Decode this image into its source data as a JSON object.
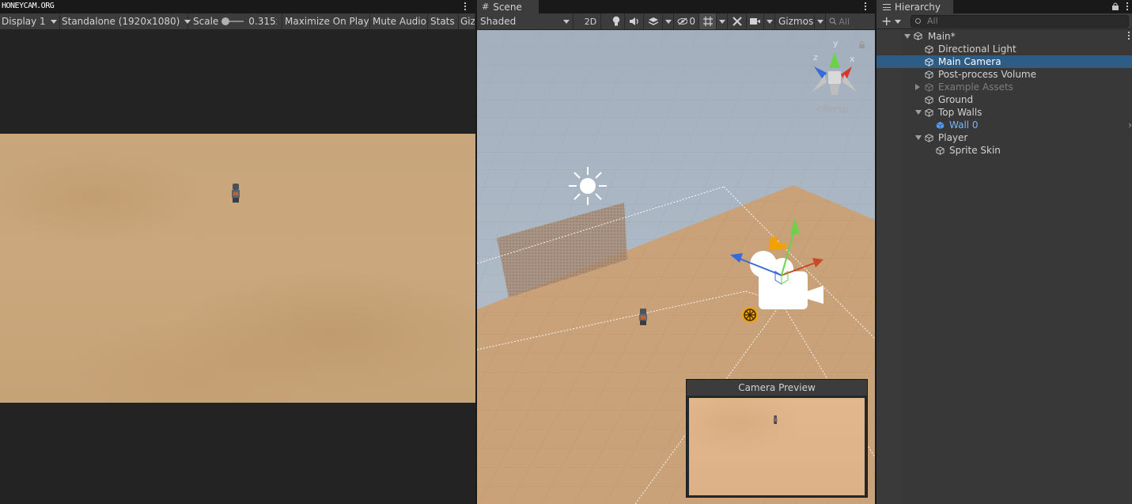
{
  "watermark": "HONEYCAM.ORG",
  "game": {
    "display": "Display 1",
    "resolution": "Standalone (1920x1080)",
    "scale_label": "Scale",
    "scale_value": "0.315x",
    "maximize": "Maximize On Play",
    "mute": "Mute Audio",
    "stats": "Stats",
    "gizmos": "Gizmos"
  },
  "scene": {
    "tab": "Scene",
    "shading": "Shaded",
    "mode_2d": "2D",
    "hidden_count": "0",
    "gizmos": "Gizmos",
    "search_placeholder": "All",
    "persp": "Persp",
    "gizmo_axes": {
      "x": "x",
      "y": "y",
      "z": "z"
    },
    "camera_preview_title": "Camera Preview"
  },
  "hierarchy": {
    "tab": "Hierarchy",
    "search_placeholder": "All",
    "add_symbol": "+",
    "items": [
      {
        "label": "Main*",
        "depth": 0,
        "expanded": true,
        "kind": "scene"
      },
      {
        "label": "Directional Light",
        "depth": 1,
        "kind": "object"
      },
      {
        "label": "Main Camera",
        "depth": 1,
        "kind": "object",
        "selected": true
      },
      {
        "label": "Post-process Volume",
        "depth": 1,
        "kind": "object"
      },
      {
        "label": "Example Assets",
        "depth": 1,
        "kind": "object",
        "collapsed": true,
        "disabled": true
      },
      {
        "label": "Ground",
        "depth": 1,
        "kind": "object"
      },
      {
        "label": "Top Walls",
        "depth": 1,
        "kind": "object",
        "expanded": true
      },
      {
        "label": "Wall 0",
        "depth": 2,
        "kind": "prefab"
      },
      {
        "label": "Player",
        "depth": 1,
        "kind": "object",
        "expanded": true
      },
      {
        "label": "Sprite Skin",
        "depth": 2,
        "kind": "object"
      }
    ]
  },
  "colors": {
    "selection": "#2c5d87",
    "prefab_text": "#7ab3ff",
    "ground": "#caa77c",
    "sky": "#a8b4c2"
  }
}
